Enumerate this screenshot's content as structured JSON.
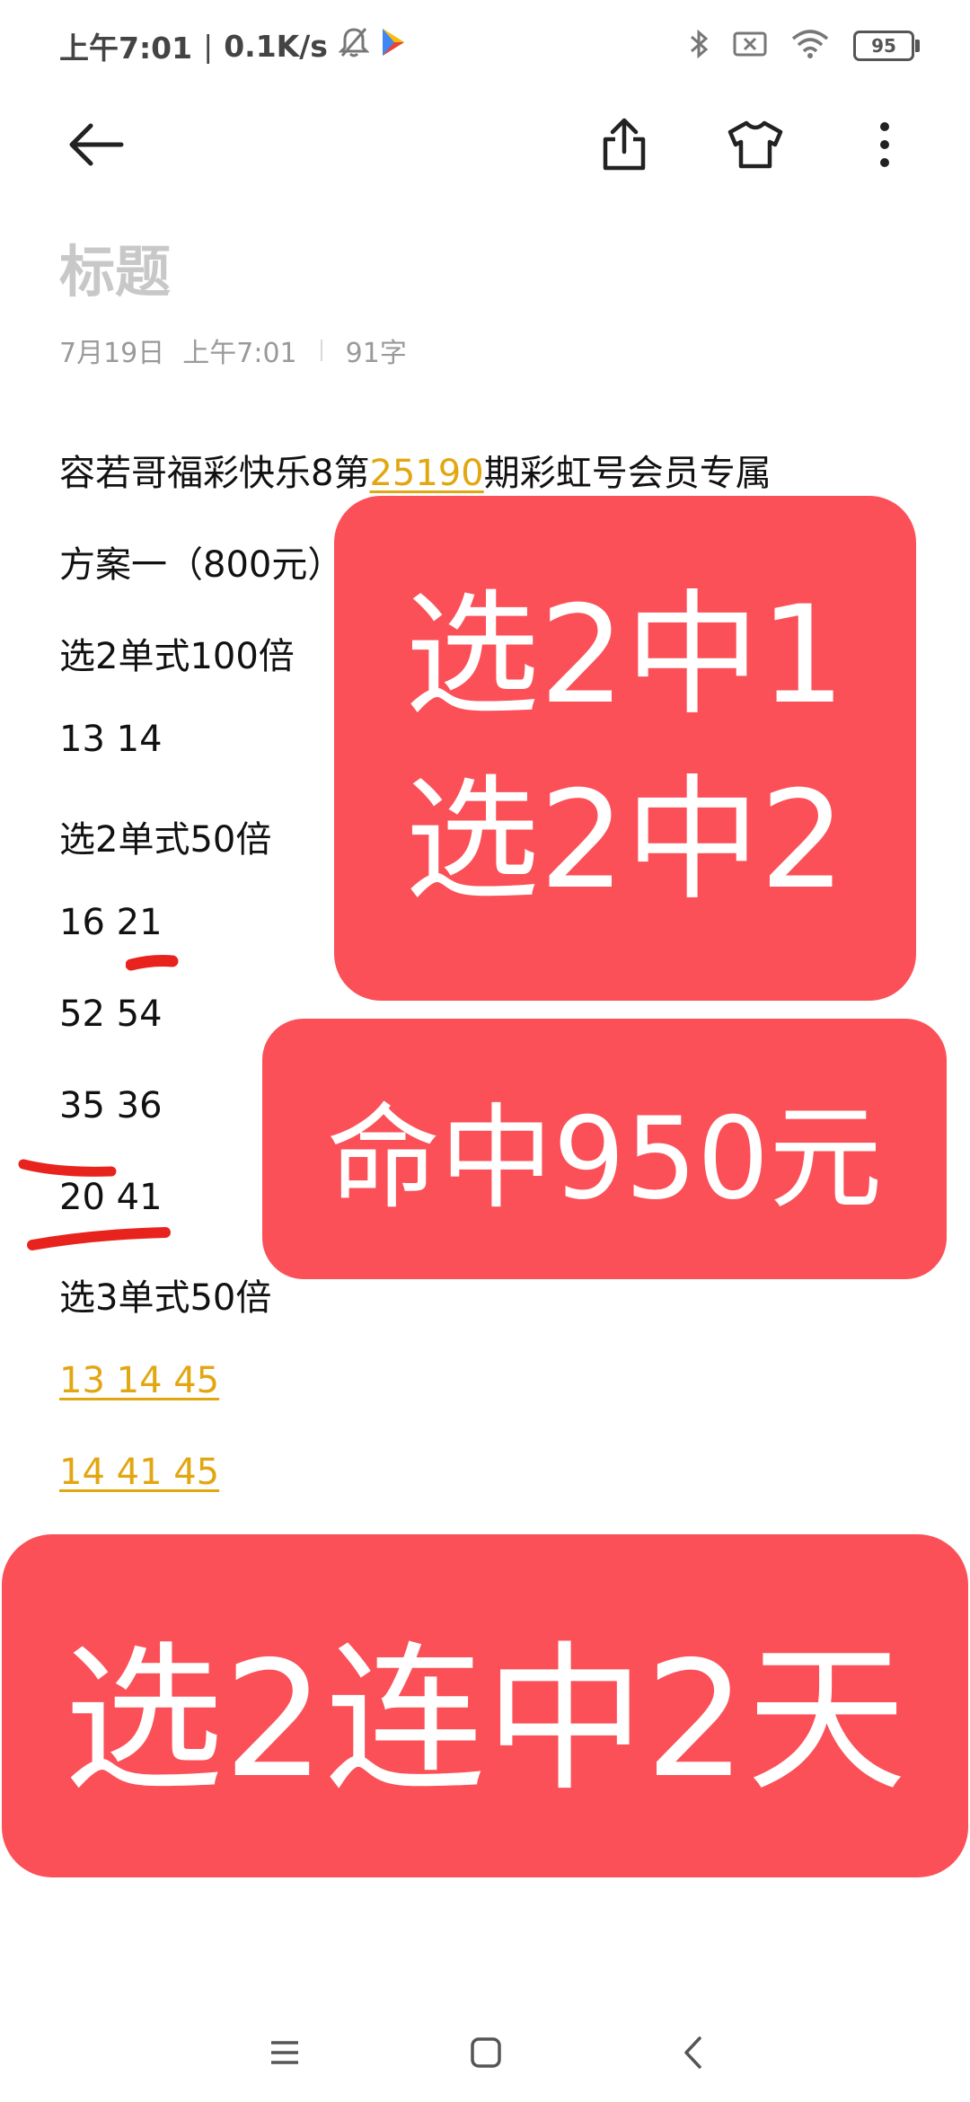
{
  "status_bar": {
    "time": "上午7:01",
    "separator": "|",
    "network_speed": "0.1K/s",
    "battery_level": "95",
    "icons": [
      "bell-off-icon",
      "play-store-icon",
      "bluetooth-icon",
      "sim-no-signal-icon",
      "wifi-icon",
      "battery-icon"
    ]
  },
  "toolbar": {
    "back_icon": "arrow-left-icon",
    "share_icon": "share-icon",
    "theme_icon": "tshirt-icon",
    "more_icon": "more-vertical-icon"
  },
  "note": {
    "title_placeholder": "标题",
    "date": "7月19日",
    "time": "上午7:01",
    "word_count": "91字",
    "heading_prefix": "容若哥福彩快乐8第",
    "heading_link": "25190",
    "heading_suffix": "期彩虹号会员专属",
    "lines": [
      "方案一（800元）",
      "选2单式100倍",
      "13 14",
      "选2单式50倍",
      "16 21",
      "52 54",
      "35 36",
      "20 41",
      "选3单式50倍"
    ],
    "link_lines": [
      "13 14 45",
      "14 41 45"
    ]
  },
  "overlays": {
    "badge1_line1": "选2中1",
    "badge1_line2": "选2中2",
    "badge2": "命中950元",
    "badge3": "选2连中2天",
    "color": "#fb5058"
  },
  "nav_bar": {
    "menu_icon": "menu-icon",
    "home_icon": "home-square-icon",
    "back_icon": "chevron-left-icon"
  }
}
